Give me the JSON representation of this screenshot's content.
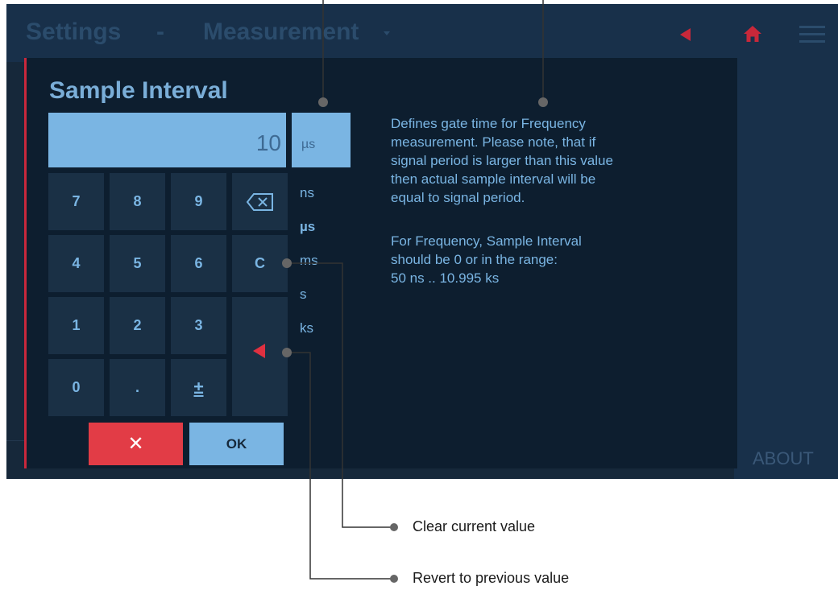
{
  "header": {
    "section": "Settings",
    "separator": "-",
    "page": "Measurement"
  },
  "footer": {
    "about_label": "ABOUT"
  },
  "dialog": {
    "title": "Sample Interval",
    "value": "10",
    "unit": "µs",
    "units": [
      "ns",
      "µs",
      "ms",
      "s",
      "ks"
    ],
    "selected_unit": "µs",
    "keypad": {
      "rows": [
        [
          "7",
          "8",
          "9"
        ],
        [
          "4",
          "5",
          "6"
        ],
        [
          "1",
          "2",
          "3"
        ],
        [
          "0",
          ".",
          "±"
        ]
      ],
      "clear_label": "C"
    },
    "cancel_label": "✕",
    "ok_label": "OK",
    "description": [
      "Defines gate time for Frequency",
      "measurement. Please note, that if",
      "signal period is larger than this value",
      "then actual sample interval will be",
      "equal to signal period.",
      "For Frequency, Sample Interval",
      "should be 0 or in the range:",
      "50 ns .. 10.995 ks"
    ]
  },
  "callouts": {
    "clear": "Clear current value",
    "revert": "Revert to previous value"
  },
  "colors": {
    "accent_red": "#e23c46",
    "key_blue": "#7ab5e3",
    "screen_bg": "#16283a",
    "dialog_bg": "#0d1e2f"
  },
  "icons": {
    "back": "back-triangle-icon",
    "home": "home-icon",
    "menu": "hamburger-menu-icon",
    "backspace": "backspace-icon",
    "revert": "revert-triangle-icon",
    "cancel": "close-icon"
  }
}
